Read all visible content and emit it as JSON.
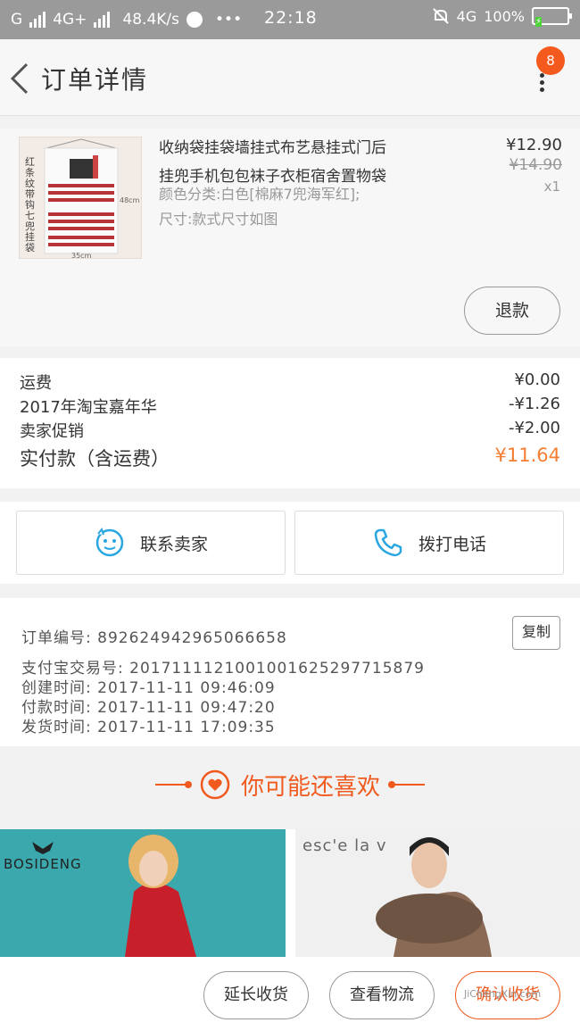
{
  "status_bar": {
    "carrier1": "G",
    "carrier2": "4G+",
    "net_speed": "48.4K/s",
    "dots": "•••",
    "time": "22:18",
    "network": "4G",
    "battery": "100%"
  },
  "header": {
    "title": "订单详情",
    "badge_count": "8"
  },
  "product": {
    "title_line1": "收纳袋挂袋墙挂式布艺悬挂式门后",
    "title_line2": "挂兜手机包包袜子衣柜宿舍置物袋",
    "spec_line1": "颜色分类:白色[棉麻7兜海军红];",
    "spec_line2": "尺寸:款式尺寸如图",
    "price": "¥12.90",
    "original_price": "¥14.90",
    "quantity": "x1",
    "refund_label": "退款",
    "thumb_caption": "红条纹带钩七兜挂袋",
    "thumb_height": "48cm",
    "thumb_width": "35cm"
  },
  "cost": {
    "rows": [
      {
        "label": "运费",
        "value": "¥0.00"
      },
      {
        "label": "2017年淘宝嘉年华",
        "value": "-¥1.26"
      },
      {
        "label": "卖家促销",
        "value": "-¥2.00"
      }
    ],
    "total_label": "实付款（含运费）",
    "total_value": "¥11.64"
  },
  "actions": {
    "contact_seller": "联系卖家",
    "call_phone": "拨打电话"
  },
  "order_info": {
    "order_no": "订单编号: 892624942965066658",
    "alipay_no": "支付宝交易号: 2017111121001001625297715879",
    "created": "创建时间: 2017-11-11  09:46:09",
    "paid": "付款时间: 2017-11-11  09:47:20",
    "shipped": "发货时间: 2017-11-11  17:09:35",
    "copy_label": "复制"
  },
  "recommend": {
    "title": "你可能还喜欢",
    "items": [
      {
        "brand": "BOSIDENG"
      },
      {
        "brand": "esc'e la v"
      }
    ]
  },
  "bottom_bar": {
    "extend": "延长收货",
    "logistics": "查看物流",
    "confirm": "确认收货"
  },
  "watermark": "JiChengXin.com",
  "colors": {
    "accent": "#f05a1e",
    "price_accent": "#f47e32",
    "status_bar": "#9a9a9a",
    "icon_blue": "#2aa7e0"
  }
}
